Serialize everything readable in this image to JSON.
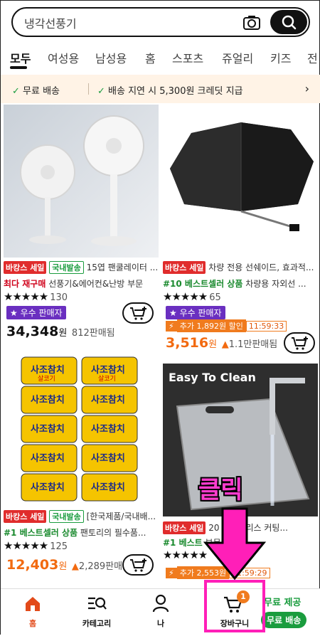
{
  "search": {
    "placeholder": "냉각선풍기",
    "value": "냉각선풍기"
  },
  "tabs": [
    "모두",
    "여성용",
    "남성용",
    "홈",
    "스포츠",
    "쥬얼리",
    "키즈",
    "전"
  ],
  "promo": {
    "item1": "무료 배송",
    "item2": "배송 지연 시 5,300원 크레딧 지급"
  },
  "products": [
    {
      "badge1": "바캉스 세일",
      "badge2": "국내발송",
      "title": "15엽 팬쿨레이터 ...",
      "highlight": "최다 재구매",
      "subtitle": "선풍기&에어컨&난방 부문",
      "stars": "★★★★★",
      "reviews": "130",
      "seller": "우수 판매자",
      "price_num": "34,348",
      "currency": "원",
      "sold": "812판매됨"
    },
    {
      "badge1": "바캉스 세일",
      "title": "차량 전용 선쉐이드, 효과적...",
      "highlight": "#10 베스트셀러 상품",
      "subtitle": "차량용 자외선 ...",
      "stars": "★★★★★",
      "reviews": "65",
      "seller": "우수 판매자",
      "discount": "추가 1,892원 할인",
      "timer": "11:59:33",
      "price_num": "3,516",
      "currency": "원",
      "sold": "1.1만판매됨"
    },
    {
      "badge1": "바캉스 세일",
      "badge2": "국내발송",
      "title": "[한국제품/국내배...",
      "highlight": "#1 베스트셀러 상품",
      "subtitle": "팬토리의 필수품...",
      "stars": "★★★★★",
      "reviews": "125",
      "price_num": "12,403",
      "currency": "원",
      "sold": "2,289판매됨",
      "image_text": "사조참치",
      "image_subtext": "살코기"
    },
    {
      "badge1": "바캉스 세일",
      "title": "20 스테인리스 커팅...",
      "highlight": "#1 베스트",
      "subtitle": "부문",
      "stars": "★★★★★",
      "discount": "추가 2,553원",
      "timer": "11:59:29",
      "image_text": "Easy To Clean"
    }
  ],
  "nav": [
    {
      "label": "홈",
      "icon": "home-icon"
    },
    {
      "label": "카테고리",
      "icon": "category-search-icon"
    },
    {
      "label": "나",
      "icon": "person-icon"
    },
    {
      "label": "장바구니",
      "icon": "cart-icon",
      "badge": "1"
    }
  ],
  "free_shipping_overlay": {
    "line1": "무료 제공",
    "line2": "무료 배송"
  },
  "annotation": {
    "text": "클릭"
  },
  "colors": {
    "accent": "#f26a10",
    "annotation": "#ff1fb8",
    "seller_badge": "#6a2fc0",
    "sale_badge": "#e02c2c"
  }
}
